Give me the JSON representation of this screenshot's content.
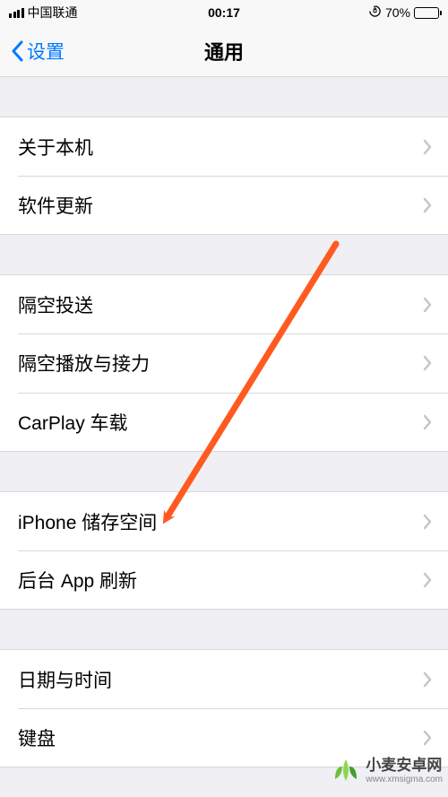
{
  "status": {
    "carrier": "中国联通",
    "time": "00:17",
    "battery_pct": "70%"
  },
  "nav": {
    "back_label": "设置",
    "title": "通用"
  },
  "groups": [
    {
      "items": [
        {
          "label": "关于本机"
        },
        {
          "label": "软件更新"
        }
      ]
    },
    {
      "items": [
        {
          "label": "隔空投送"
        },
        {
          "label": "隔空播放与接力"
        },
        {
          "label": "CarPlay 车载"
        }
      ]
    },
    {
      "items": [
        {
          "label": "iPhone 储存空间"
        },
        {
          "label": "后台 App 刷新"
        }
      ]
    },
    {
      "items": [
        {
          "label": "日期与时间"
        },
        {
          "label": "键盘"
        }
      ]
    }
  ],
  "watermark": {
    "text": "小麦安卓网",
    "url": "www.xmsigma.com"
  },
  "annotation": {
    "arrow_color": "#ff5a1f"
  }
}
